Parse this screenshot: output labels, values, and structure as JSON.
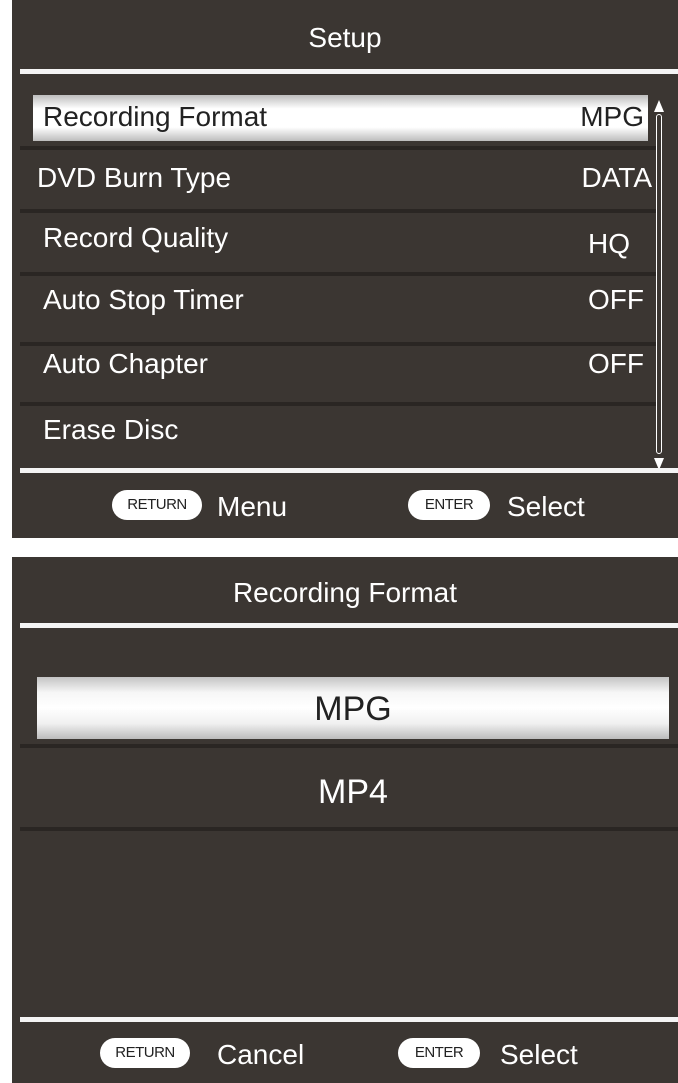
{
  "setup": {
    "title": "Setup",
    "items": [
      {
        "label": "Recording Format",
        "value": "MPG"
      },
      {
        "label": "DVD Burn Type",
        "value": "DATA"
      },
      {
        "label": "Record Quality",
        "value": "HQ"
      },
      {
        "label": "Auto Stop Timer",
        "value": "OFF"
      },
      {
        "label": "Auto Chapter",
        "value": "OFF"
      },
      {
        "label": "Erase Disc",
        "value": ""
      }
    ],
    "footer": {
      "return_key": "RETURN",
      "return_label": "Menu",
      "enter_key": "ENTER",
      "enter_label": "Select"
    }
  },
  "recording_format": {
    "title": "Recording Format",
    "options": [
      "MPG",
      "MP4"
    ],
    "footer": {
      "return_key": "RETURN",
      "return_label": "Cancel",
      "enter_key": "ENTER",
      "enter_label": "Select"
    }
  },
  "colors": {
    "panel_background": "#3b3632",
    "text": "#ffffff",
    "highlight": "#ffffff"
  }
}
